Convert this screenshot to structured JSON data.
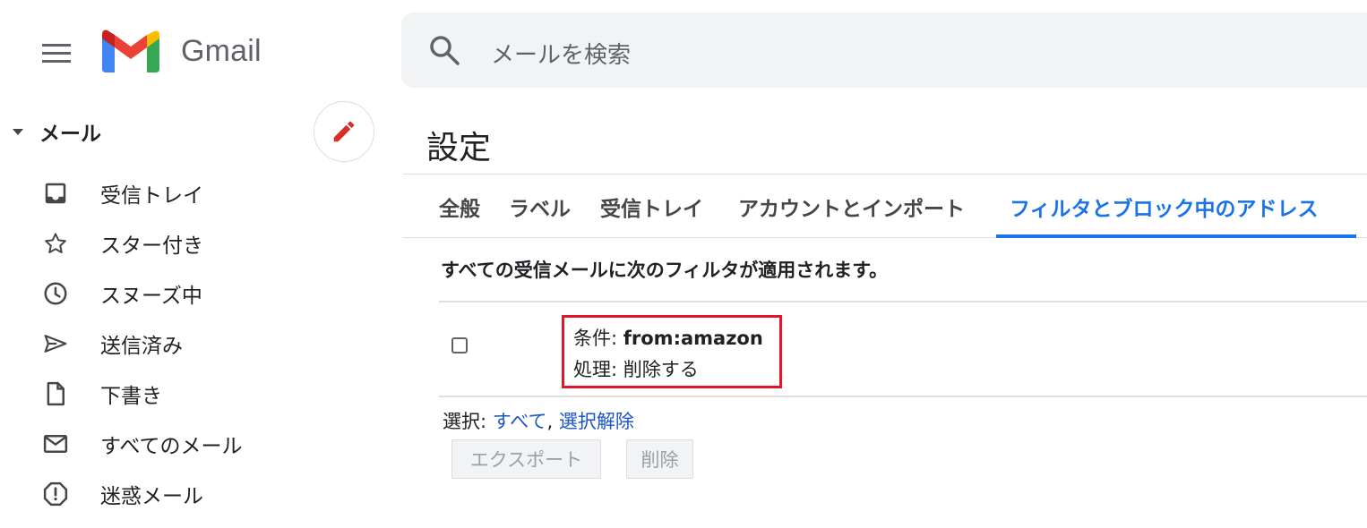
{
  "header": {
    "app_name": "Gmail",
    "search_placeholder": "メールを検索"
  },
  "sidebar": {
    "section_label": "メール",
    "items": [
      {
        "label": "受信トレイ",
        "icon": "inbox-icon"
      },
      {
        "label": "スター付き",
        "icon": "star-icon"
      },
      {
        "label": "スヌーズ中",
        "icon": "clock-icon"
      },
      {
        "label": "送信済み",
        "icon": "send-icon"
      },
      {
        "label": "下書き",
        "icon": "draft-icon"
      },
      {
        "label": "すべてのメール",
        "icon": "mail-icon"
      },
      {
        "label": "迷惑メール",
        "icon": "spam-icon"
      }
    ]
  },
  "settings": {
    "title": "設定",
    "tabs": [
      {
        "label": "全般",
        "active": false
      },
      {
        "label": "ラベル",
        "active": false
      },
      {
        "label": "受信トレイ",
        "active": false
      },
      {
        "label": "アカウントとインポート",
        "active": false
      },
      {
        "label": "フィルタとブロック中のアドレス",
        "active": true
      }
    ],
    "filter_intro": "すべての受信メールに次のフィルタが適用されます。",
    "filter": {
      "criteria_label": "条件: ",
      "criteria_value": "from:amazon",
      "action_label": "処理: ",
      "action_value": "削除する",
      "checked": false
    },
    "select": {
      "label": "選択: ",
      "all_link": "すべて",
      "separator": ", ",
      "none_link": "選択解除"
    },
    "buttons": {
      "export": "エクスポート",
      "delete": "削除"
    }
  },
  "colors": {
    "accent": "#1a73e8",
    "link": "#1a56c4",
    "highlight": "#e0172a",
    "compose_pencil": "#d93025"
  }
}
